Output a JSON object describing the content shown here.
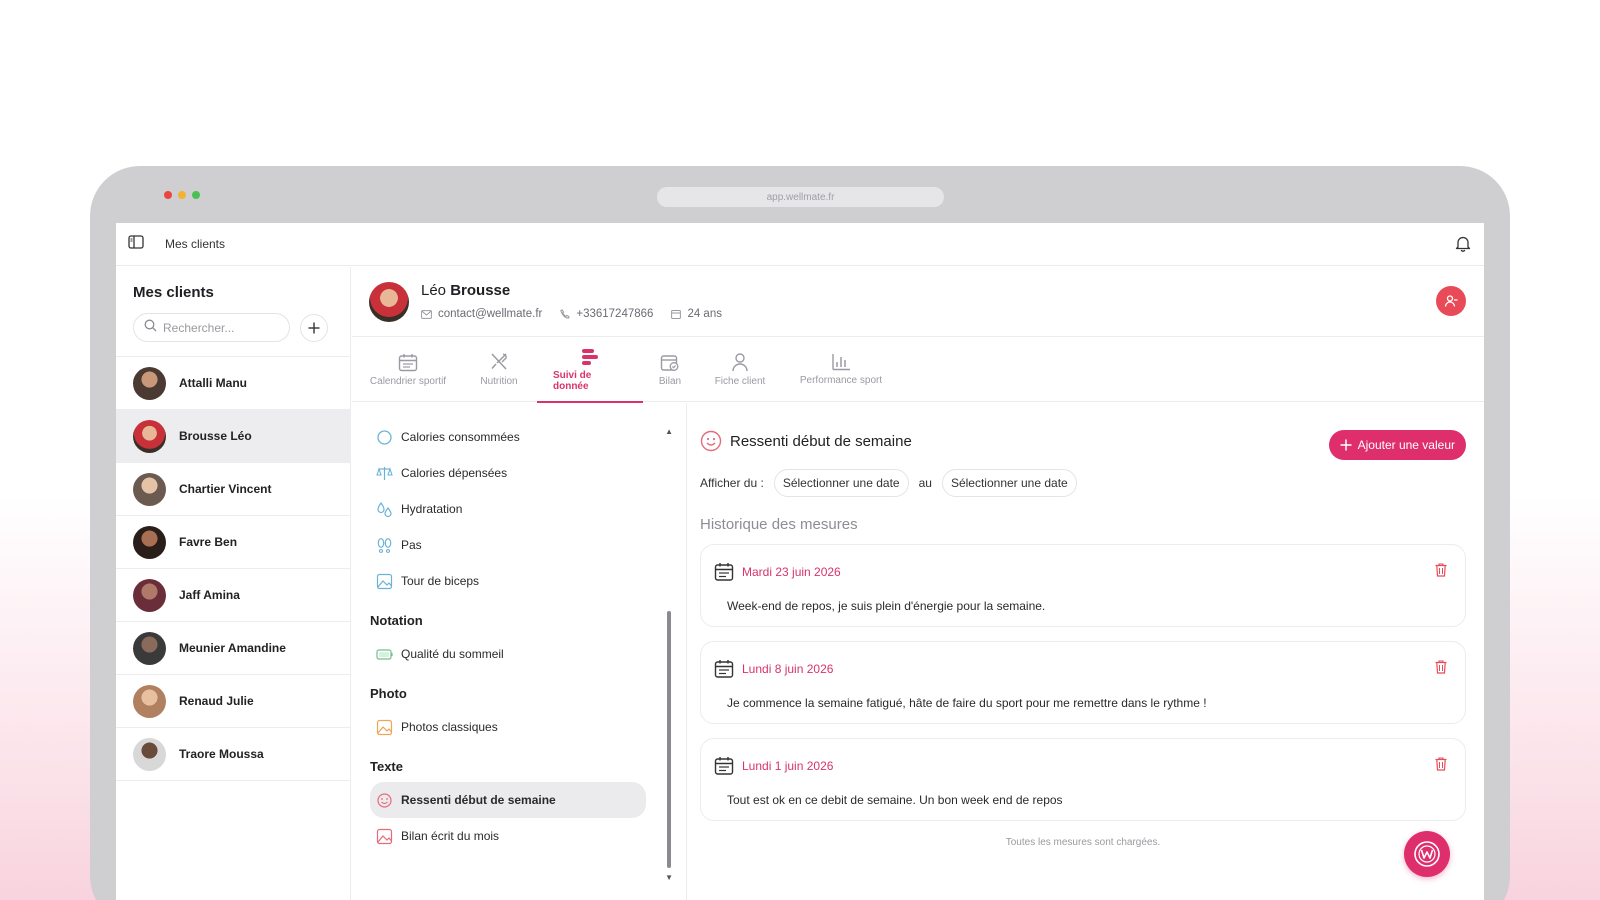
{
  "browser": {
    "url": "app.wellmate.fr",
    "dot_colors": [
      "#e8463e",
      "#f4b233",
      "#4cbf56"
    ]
  },
  "topbar": {
    "breadcrumb": "Mes clients"
  },
  "sidebar": {
    "title": "Mes clients",
    "search_placeholder": "Rechercher...",
    "clients": [
      {
        "name": "Attalli Manu"
      },
      {
        "name": "Brousse Léo"
      },
      {
        "name": "Chartier Vincent"
      },
      {
        "name": "Favre Ben"
      },
      {
        "name": "Jaff Amina"
      },
      {
        "name": "Meunier Amandine"
      },
      {
        "name": "Renaud Julie"
      },
      {
        "name": "Traore Moussa"
      }
    ],
    "active_client": "Brousse Léo"
  },
  "profile": {
    "first_name": "Léo",
    "last_name": "Brousse",
    "email": "contact@wellmate.fr",
    "phone": "+33617247866",
    "age": "24 ans"
  },
  "tabs": [
    {
      "label": "Calendrier sportif",
      "icon": "calendar-icon"
    },
    {
      "label": "Nutrition",
      "icon": "utensils-icon"
    },
    {
      "label": "Suivi de donnée",
      "icon": "data-tracking-icon"
    },
    {
      "label": "Bilan",
      "icon": "report-icon"
    },
    {
      "label": "Fiche client",
      "icon": "user-icon"
    },
    {
      "label": "Performance sport",
      "icon": "bar-chart-icon"
    }
  ],
  "active_tab": "Suivi de donnée",
  "metrics": {
    "items_top": [
      {
        "label": "Calories consommées",
        "icon": "ring-icon"
      },
      {
        "label": "Calories dépensées",
        "icon": "scale-icon"
      },
      {
        "label": "Hydratation",
        "icon": "drops-icon"
      },
      {
        "label": "Pas",
        "icon": "footprints-icon"
      },
      {
        "label": "Tour de biceps",
        "icon": "image-icon"
      }
    ],
    "sections": [
      {
        "title": "Notation",
        "items": [
          {
            "label": "Qualité du sommeil",
            "icon": "battery-icon"
          }
        ]
      },
      {
        "title": "Photo",
        "items": [
          {
            "label": "Photos classiques",
            "icon": "photo-icon"
          }
        ]
      },
      {
        "title": "Texte",
        "items": [
          {
            "label": "Ressenti début de semaine",
            "icon": "smiley-icon"
          },
          {
            "label": "Bilan écrit du mois",
            "icon": "image-icon"
          }
        ]
      }
    ]
  },
  "detail": {
    "title": "Ressenti début de semaine",
    "add_button": "Ajouter une valeur",
    "filter_label": "Afficher du :",
    "date_placeholder_from": "Sélectionner une date",
    "between_label": "au",
    "date_placeholder_to": "Sélectionner une date",
    "history_title": "Historique des mesures",
    "entries": [
      {
        "date": "Mardi 23 juin 2026",
        "text": "Week-end de repos, je suis plein d'énergie pour la semaine."
      },
      {
        "date": "Lundi 8 juin 2026",
        "text": "Je commence la semaine fatigué, hâte de faire du sport pour me remettre dans le rythme !"
      },
      {
        "date": "Lundi 1 juin 2026",
        "text": "Tout est ok en ce debit de semaine. Un bon week end de repos"
      }
    ],
    "footer_note": "Toutes les mesures sont chargées."
  },
  "colors": {
    "accent": "#de2f6c",
    "danger": "#e94a57"
  }
}
